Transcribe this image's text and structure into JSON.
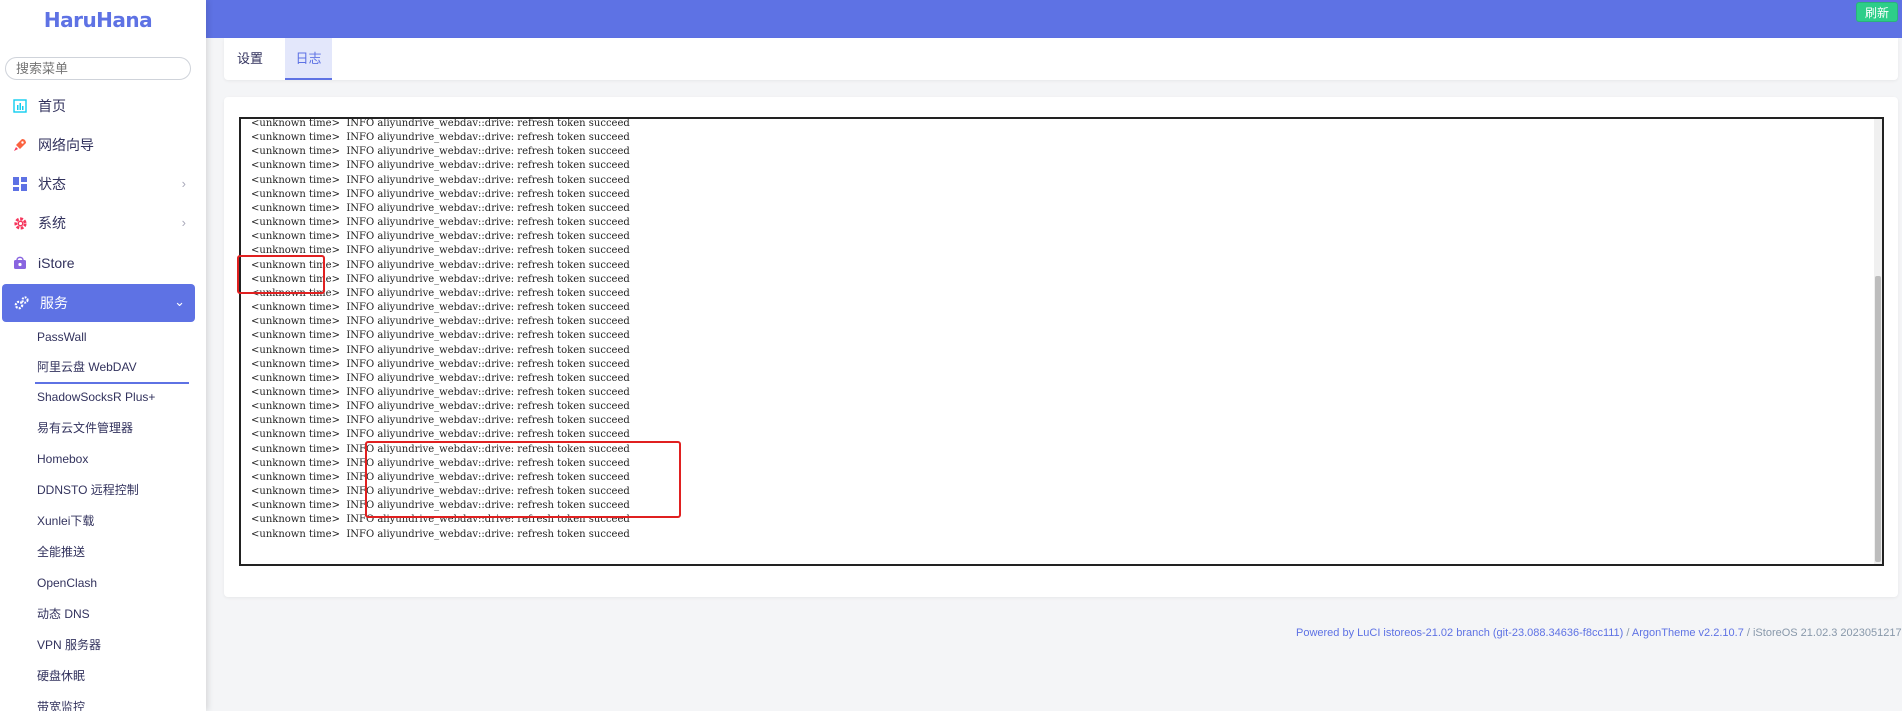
{
  "brand": "HaruHana",
  "search": {
    "placeholder": "搜索菜单"
  },
  "menu": {
    "home": "首页",
    "wizard": "网络向导",
    "status": "状态",
    "system": "系统",
    "istore": "iStore",
    "services": "服务"
  },
  "services_submenu": [
    "PassWall",
    "阿里云盘 WebDAV",
    "ShadowSocksR Plus+",
    "易有云文件管理器",
    "Homebox",
    "DDNSTO 远程控制",
    "Xunlei下载",
    "全能推送",
    "OpenClash",
    "动态 DNS",
    "VPN 服务器",
    "硬盘休眠",
    "带宽监控"
  ],
  "header": {
    "refresh_label": "刷新"
  },
  "tabs": {
    "settings": "设置",
    "log": "日志"
  },
  "log": {
    "line": "<unknown time>  INFO aliyundrive_webdav::drive: refresh token succeed",
    "line_count": 30
  },
  "footer": {
    "text": "Powered by LuCI istoreos-21.02 branch (git-23.088.34636-f8cc111)",
    "sep1": " / ",
    "theme": "ArgonTheme v2.2.10.7",
    "sep2": " / ",
    "os": "iStoreOS 21.02.3 2023051217"
  },
  "colors": {
    "accent": "#5e72e4",
    "refresh_button": "#2dce89",
    "highlight": "#e02020"
  }
}
